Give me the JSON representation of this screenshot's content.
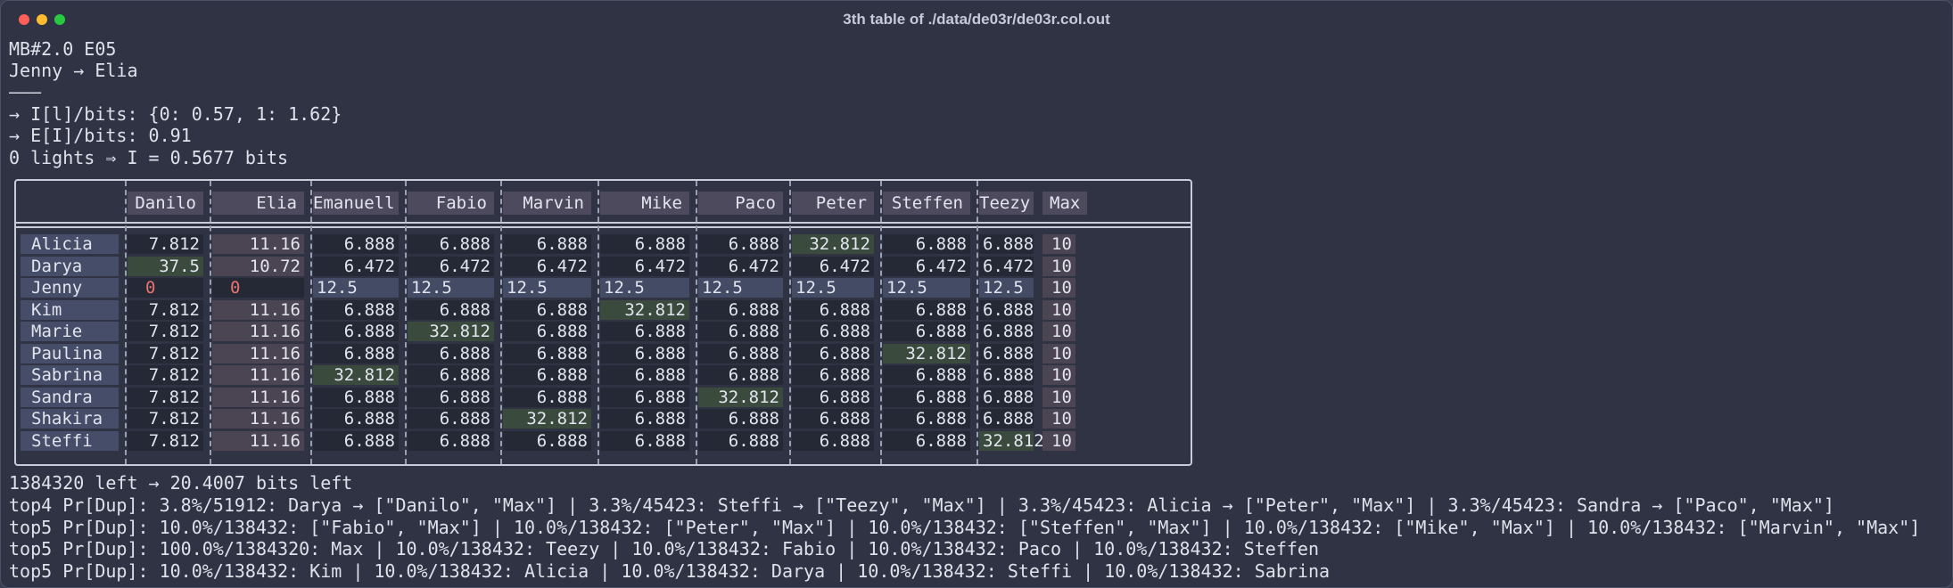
{
  "window": {
    "title": "3th table of ./data/de03r/de03r.col.out"
  },
  "header_lines": [
    "MB#2.0 E05",
    "Jenny → Elia",
    "———",
    "→ I[l]/bits: {0: 0.57, 1: 1.62}",
    "→ E[I]/bits: 0.91",
    "0 lights ⇒ I = 0.5677 bits"
  ],
  "table": {
    "columns": [
      "Danilo",
      "Elia",
      "Emanuell",
      "Fabio",
      "Marvin",
      "Mike",
      "Paco",
      "Peter",
      "Steffen",
      "Teezy",
      "Max"
    ],
    "rows": [
      {
        "name": "Alicia",
        "cells": [
          "7.812",
          "11.16",
          "6.888",
          "6.888",
          "6.888",
          "6.888",
          "6.888",
          "32.812",
          "6.888",
          "6.888",
          "10"
        ]
      },
      {
        "name": "Darya",
        "cells": [
          "37.5",
          "10.72",
          "6.472",
          "6.472",
          "6.472",
          "6.472",
          "6.472",
          "6.472",
          "6.472",
          "6.472",
          "10"
        ]
      },
      {
        "name": "Jenny",
        "cells": [
          "0",
          "0",
          "12.5",
          "12.5",
          "12.5",
          "12.5",
          "12.5",
          "12.5",
          "12.5",
          "12.5",
          "10"
        ]
      },
      {
        "name": "Kim",
        "cells": [
          "7.812",
          "11.16",
          "6.888",
          "6.888",
          "6.888",
          "32.812",
          "6.888",
          "6.888",
          "6.888",
          "6.888",
          "10"
        ]
      },
      {
        "name": "Marie",
        "cells": [
          "7.812",
          "11.16",
          "6.888",
          "32.812",
          "6.888",
          "6.888",
          "6.888",
          "6.888",
          "6.888",
          "6.888",
          "10"
        ]
      },
      {
        "name": "Paulina",
        "cells": [
          "7.812",
          "11.16",
          "6.888",
          "6.888",
          "6.888",
          "6.888",
          "6.888",
          "6.888",
          "32.812",
          "6.888",
          "10"
        ]
      },
      {
        "name": "Sabrina",
        "cells": [
          "7.812",
          "11.16",
          "32.812",
          "6.888",
          "6.888",
          "6.888",
          "6.888",
          "6.888",
          "6.888",
          "6.888",
          "10"
        ]
      },
      {
        "name": "Sandra",
        "cells": [
          "7.812",
          "11.16",
          "6.888",
          "6.888",
          "6.888",
          "6.888",
          "32.812",
          "6.888",
          "6.888",
          "6.888",
          "10"
        ]
      },
      {
        "name": "Shakira",
        "cells": [
          "7.812",
          "11.16",
          "6.888",
          "6.888",
          "32.812",
          "6.888",
          "6.888",
          "6.888",
          "6.888",
          "6.888",
          "10"
        ]
      },
      {
        "name": "Steffi",
        "cells": [
          "7.812",
          "11.16",
          "6.888",
          "6.888",
          "6.888",
          "6.888",
          "6.888",
          "6.888",
          "6.888",
          "32.812",
          "10"
        ]
      }
    ]
  },
  "footer_lines": [
    "1384320 left → 20.4007 bits left",
    "top4 Pr[Dup]: 3.8%/51912: Darya → [\"Danilo\", \"Max\"] | 3.3%/45423: Steffi → [\"Teezy\", \"Max\"] | 3.3%/45423: Alicia → [\"Peter\", \"Max\"] | 3.3%/45423: Sandra → [\"Paco\", \"Max\"]",
    "top5 Pr[Dup]: 10.0%/138432: [\"Fabio\", \"Max\"] | 10.0%/138432: [\"Peter\", \"Max\"] | 10.0%/138432: [\"Steffen\", \"Max\"] | 10.0%/138432: [\"Mike\", \"Max\"] | 10.0%/138432: [\"Marvin\", \"Max\"]",
    "top5 Pr[Dup]: 100.0%/1384320: Max | 10.0%/138432: Teezy | 10.0%/138432: Fabio | 10.0%/138432: Paco | 10.0%/138432: Steffen",
    "top5 Pr[Dup]: 10.0%/138432: Kim | 10.0%/138432: Alicia | 10.0%/138432: Darya | 10.0%/138432: Steffi | 10.0%/138432: Sabrina"
  ]
}
